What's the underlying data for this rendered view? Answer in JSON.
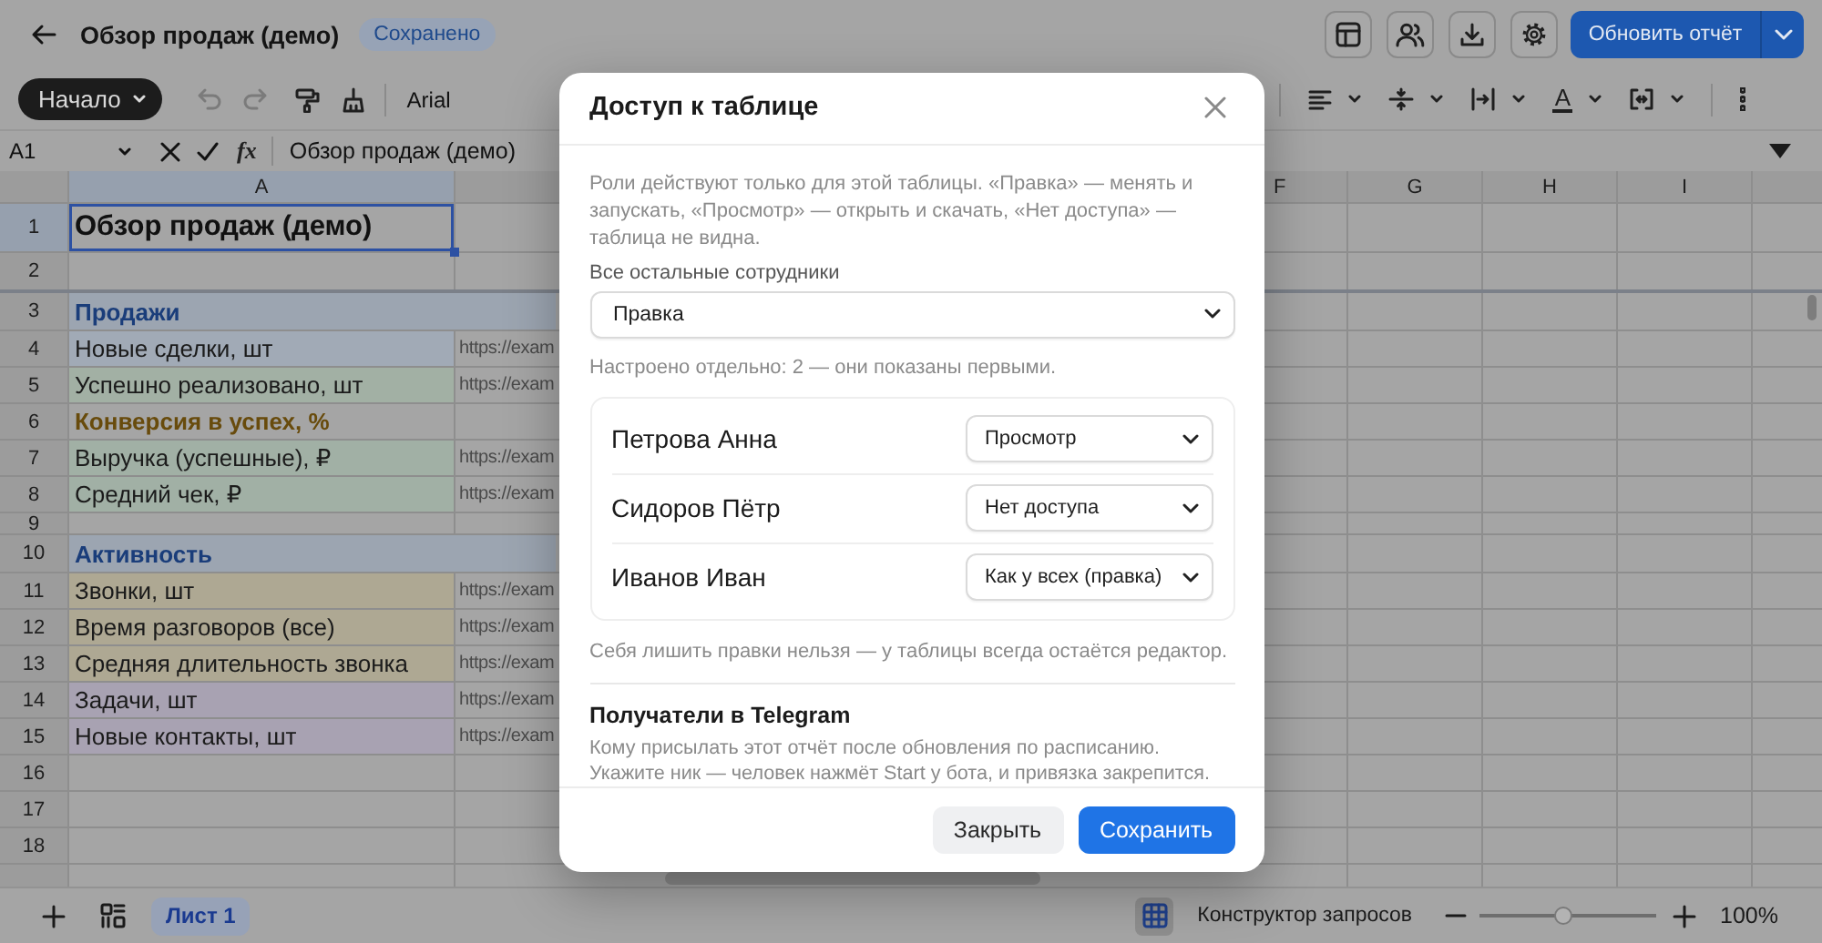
{
  "topbar": {
    "title": "Обзор продаж (демо)",
    "status": "Сохранено",
    "primary_action": "Обновить отчёт"
  },
  "toolbar": {
    "menu": "Начало",
    "undo": {
      "disabled": true
    },
    "redo": {
      "disabled": true
    },
    "font": "Arial",
    "text_color_label": "A"
  },
  "formula_bar": {
    "cell": "A1",
    "function_label": "fx",
    "value": "Обзор продаж (демо)"
  },
  "sheet": {
    "columns": [
      {
        "label": "A",
        "selected": true
      },
      {
        "label": "F",
        "selected": false
      },
      {
        "label": "G",
        "selected": false
      },
      {
        "label": "H",
        "selected": false
      },
      {
        "label": "I",
        "selected": false
      }
    ],
    "rows": [
      {
        "number": "1",
        "kind": "title",
        "label": "Обзор продаж (демо)",
        "selected": true
      },
      {
        "number": "2",
        "kind": "blank",
        "selected": false
      },
      {
        "number": "3",
        "kind": "section",
        "label": "Продажи",
        "color": "#9ca5b1",
        "selected": false
      },
      {
        "number": "4",
        "kind": "metric",
        "label": "Новые сделки, шт",
        "link": "https://exam",
        "color": "#a1aab6",
        "selected": false
      },
      {
        "number": "5",
        "kind": "metric",
        "label": "Успешно реализовано, шт",
        "link": "https://exam",
        "color": "#a2b0a4",
        "selected": false
      },
      {
        "number": "6",
        "kind": "subsection",
        "label": "Конверсия в успех, %",
        "selected": false
      },
      {
        "number": "7",
        "kind": "metric",
        "label": "Выручка (успешные), ₽",
        "link": "https://exam",
        "color": "#a1b0a5",
        "selected": false
      },
      {
        "number": "8",
        "kind": "metric",
        "label": "Средний чек, ₽",
        "link": "https://exam",
        "color": "#a1b0a5",
        "selected": false
      },
      {
        "number": "9",
        "kind": "spacer",
        "selected": false
      },
      {
        "number": "10",
        "kind": "section",
        "label": "Активность",
        "color": "#9ca5b1",
        "selected": false
      },
      {
        "number": "11",
        "kind": "metric",
        "label": "Звонки, шт",
        "link": "https://exam",
        "color": "#aea893",
        "selected": false
      },
      {
        "number": "12",
        "kind": "metric",
        "label": "Время разговоров (все)",
        "link": "https://exam",
        "color": "#aea893",
        "selected": false
      },
      {
        "number": "13",
        "kind": "metric",
        "label": "Средняя длительность звонка",
        "link": "https://exam",
        "color": "#aea893",
        "selected": false
      },
      {
        "number": "14",
        "kind": "metric",
        "label": "Задачи, шт",
        "link": "https://exam",
        "color": "#a8a2b2",
        "selected": false
      },
      {
        "number": "15",
        "kind": "metric",
        "label": "Новые контакты, шт",
        "link": "https://exam",
        "color": "#a8a2b2",
        "selected": false
      },
      {
        "number": "16",
        "kind": "blank",
        "selected": false
      },
      {
        "number": "17",
        "kind": "blank",
        "selected": false
      },
      {
        "number": "18",
        "kind": "blank",
        "selected": false
      }
    ]
  },
  "bottom_bar": {
    "sheets": [
      {
        "label": "Лист 1",
        "selected": true
      }
    ],
    "query_builder": "Конструктор запросов",
    "zoom": {
      "level": 0.47,
      "reading": "100%"
    }
  },
  "dialog": {
    "title": "Доступ к таблице",
    "intro": "Роли действуют только для этой таблицы. «Правка» — менять и запускать, «Просмотр» — открыть и скачать, «Нет доступа» — таблица не видна.",
    "default_label": "Все остальные сотрудники",
    "default_role": "Правка",
    "custom_note": "Настроено отдельно: 2 — они показаны первыми.",
    "members": [
      {
        "name": "Петрова Анна",
        "role": "Просмотр"
      },
      {
        "name": "Сидоров Пётр",
        "role": "Нет доступа"
      },
      {
        "name": "Иванов Иван",
        "role": "Как у всех (правка)"
      }
    ],
    "self_note": "Себя лишить правки нельзя — у таблицы всегда остаётся редактор.",
    "telegram": {
      "title": "Получатели в Telegram",
      "description": [
        "Кому присылать этот отчёт после обновления по расписанию.",
        "Укажите ник — человек нажмёт Start у бота, и привязка закрепится."
      ]
    },
    "buttons": [
      {
        "label": "Закрыть",
        "kind": "secondary"
      },
      {
        "label": "Сохранить",
        "kind": "primary"
      }
    ]
  }
}
